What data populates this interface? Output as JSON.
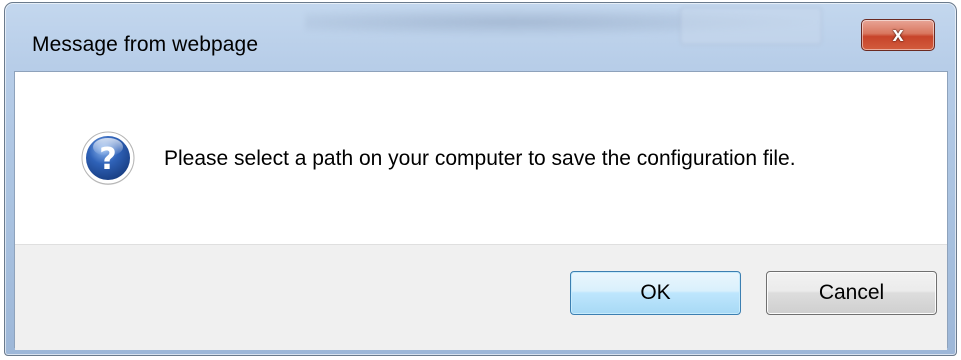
{
  "dialog": {
    "title": "Message from webpage",
    "close_label": "x",
    "icon": "question-icon",
    "message": "Please select a path on your computer to save the configuration file.",
    "buttons": {
      "ok_label": "OK",
      "cancel_label": "Cancel"
    }
  },
  "colors": {
    "title_bar": "#b7cde8",
    "close_button": "#c7442a",
    "ok_button_border": "#3c7fb1",
    "button_area": "#f0f0f0",
    "icon_blue": "#2a5aa8"
  }
}
